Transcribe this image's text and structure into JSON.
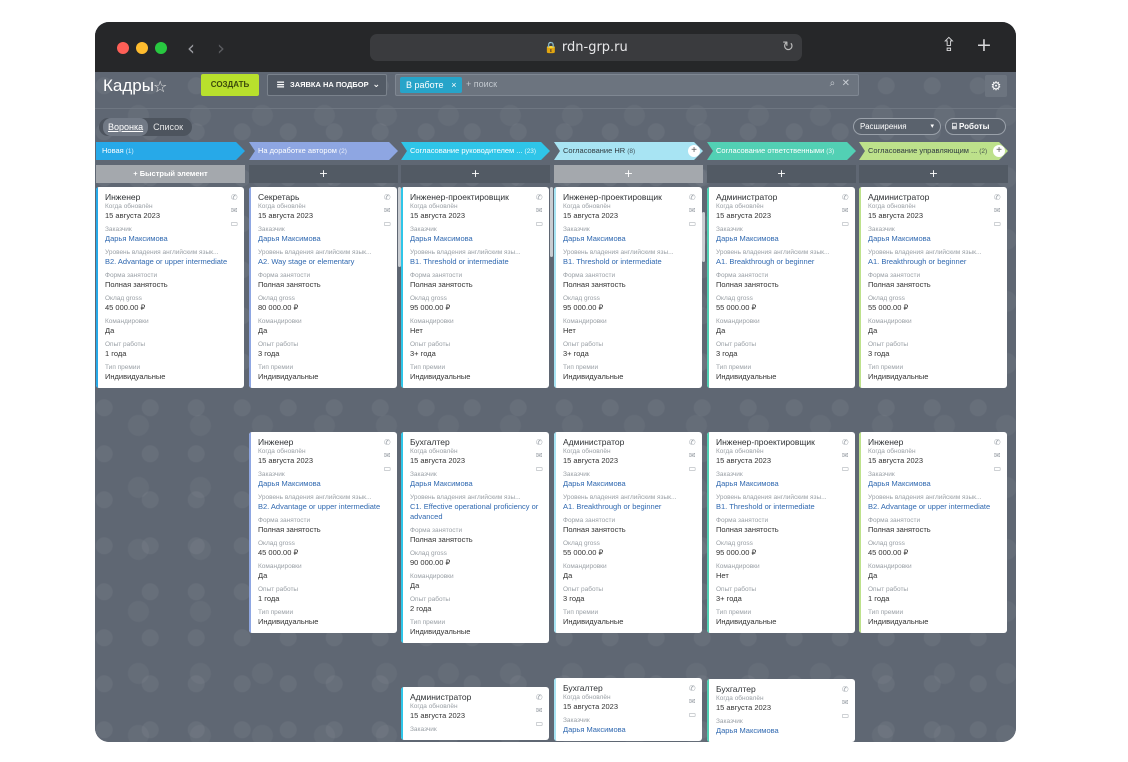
{
  "browser": {
    "url": "rdn-grp.ru",
    "back_icon": "chevron-left",
    "forward_icon": "chevron-right",
    "share_icon": "share",
    "new_tab_icon": "plus"
  },
  "header": {
    "title": "Кадры",
    "create_label": "СОЗДАТЬ",
    "filter_label": "ЗАЯВКА НА ПОДБОР",
    "search_chip": "В работе",
    "search_placeholder": "+ поиск"
  },
  "toolbar": {
    "view_funnel": "Воронка",
    "view_list": "Список",
    "extensions": "Расширения",
    "robots": "Роботы"
  },
  "colors": {
    "accent_green": "#b8e02d",
    "chip_blue": "#27a4c9",
    "link_blue": "#2f68b0"
  },
  "columns": [
    {
      "title": "Новая",
      "count": "(1)",
      "color": "#27a9e8",
      "add_label": "Быстрый элемент",
      "add_style": "quick",
      "cards": [
        {
          "title": "Инженер",
          "updated_label": "Когда обновлён",
          "updated": "15 августа 2023",
          "client_label": "Заказчик",
          "client": "Дарья Максимова",
          "english_label": "Уровень владения английским язык...",
          "english": "B2. Advantage or upper intermediate",
          "employment_label": "Форма занятости",
          "employment": "Полная занятость",
          "salary_label": "Оклад gross",
          "salary": "45 000.00 ₽",
          "trips_label": "Командировки",
          "trips": "Да",
          "experience_label": "Опыт работы",
          "experience": "1 года",
          "bonus_label": "Тип премии",
          "bonus": "Индивидуальные"
        }
      ]
    },
    {
      "title": "На доработке автором",
      "count": "(2)",
      "color": "#8ea6e2",
      "add_label": "+",
      "add_style": "plain",
      "cards": [
        {
          "title": "Секретарь",
          "updated_label": "Когда обновлён",
          "updated": "15 августа 2023",
          "client_label": "Заказчик",
          "client": "Дарья Максимова",
          "english_label": "Уровень владения английским язык...",
          "english": "A2. Way stage or elementary",
          "employment_label": "Форма занятости",
          "employment": "Полная занятость",
          "salary_label": "Оклад gross",
          "salary": "80 000.00 ₽",
          "trips_label": "Командировки",
          "trips": "Да",
          "experience_label": "Опыт работы",
          "experience": "3 года",
          "bonus_label": "Тип премии",
          "bonus": "Индивидуальные"
        },
        {
          "title": "Инженер",
          "updated_label": "Когда обновлён",
          "updated": "15 августа 2023",
          "client_label": "Заказчик",
          "client": "Дарья Максимова",
          "english_label": "Уровень владения английским язык...",
          "english": "B2. Advantage or upper intermediate",
          "employment_label": "Форма занятости",
          "employment": "Полная занятость",
          "salary_label": "Оклад gross",
          "salary": "45 000.00 ₽",
          "trips_label": "Командировки",
          "trips": "Да",
          "experience_label": "Опыт работы",
          "experience": "1 года",
          "bonus_label": "Тип премии",
          "bonus": "Индивидуальные"
        }
      ]
    },
    {
      "title": "Согласование руководителем ...",
      "count": "(23)",
      "color": "#2fc5e8",
      "add_label": "+",
      "add_style": "plain",
      "cards": [
        {
          "title": "Инженер-проектировщик",
          "updated_label": "Когда обновлён",
          "updated": "15 августа 2023",
          "client_label": "Заказчик",
          "client": "Дарья Максимова",
          "english_label": "Уровень владения английским язы...",
          "english": "B1. Threshold or intermediate",
          "employment_label": "Форма занятости",
          "employment": "Полная занятость",
          "salary_label": "Оклад gross",
          "salary": "95 000.00 ₽",
          "trips_label": "Командировки",
          "trips": "Нет",
          "experience_label": "Опыт работы",
          "experience": "3+ года",
          "bonus_label": "Тип премии",
          "bonus": "Индивидуальные"
        },
        {
          "title": "Бухгалтер",
          "updated_label": "Когда обновлён",
          "updated": "15 августа 2023",
          "client_label": "Заказчик",
          "client": "Дарья Максимова",
          "english_label": "Уровень владения английским язы...",
          "english": "C1. Effective operational proficiency or advanced",
          "employment_label": "Форма занятости",
          "employment": "Полная занятость",
          "salary_label": "Оклад gross",
          "salary": "90 000.00 ₽",
          "trips_label": "Командировки",
          "trips": "Да",
          "experience_label": "Опыт работы",
          "experience": "2 года",
          "bonus_label": "Тип премии",
          "bonus": "Индивидуальные"
        },
        {
          "title": "Администратор",
          "updated_label": "Когда обновлён",
          "updated": "15 августа 2023",
          "client_label": "Заказчик"
        }
      ]
    },
    {
      "title": "Согласование HR",
      "count": "(8)",
      "color": "#a8e4f3",
      "add_label": "+",
      "add_style": "light",
      "cards": [
        {
          "title": "Инженер-проектировщик",
          "updated_label": "Когда обновлён",
          "updated": "15 августа 2023",
          "client_label": "Заказчик",
          "client": "Дарья Максимова",
          "english_label": "Уровень владения английским язы...",
          "english": "B1. Threshold or intermediate",
          "employment_label": "Форма занятости",
          "employment": "Полная занятость",
          "salary_label": "Оклад gross",
          "salary": "95 000.00 ₽",
          "trips_label": "Командировки",
          "trips": "Нет",
          "experience_label": "Опыт работы",
          "experience": "3+ года",
          "bonus_label": "Тип премии",
          "bonus": "Индивидуальные"
        },
        {
          "title": "Администратор",
          "updated_label": "Когда обновлён",
          "updated": "15 августа 2023",
          "client_label": "Заказчик",
          "client": "Дарья Максимова",
          "english_label": "Уровень владения английским язык...",
          "english": "A1. Breakthrough or beginner",
          "employment_label": "Форма занятости",
          "employment": "Полная занятость",
          "salary_label": "Оклад gross",
          "salary": "55 000.00 ₽",
          "trips_label": "Командировки",
          "trips": "Да",
          "experience_label": "Опыт работы",
          "experience": "3 года",
          "bonus_label": "Тип премии",
          "bonus": "Индивидуальные"
        },
        {
          "title": "Бухгалтер",
          "updated_label": "Когда обновлён",
          "updated": "15 августа 2023",
          "client_label": "Заказчик",
          "client": "Дарья Максимова"
        }
      ]
    },
    {
      "title": "Согласование ответственными",
      "count": "(3)",
      "color": "#52d0b4",
      "add_label": "+",
      "add_style": "plain",
      "cards": [
        {
          "title": "Администратор",
          "updated_label": "Когда обновлён",
          "updated": "15 августа 2023",
          "client_label": "Заказчик",
          "client": "Дарья Максимова",
          "english_label": "Уровень владения английским язык...",
          "english": "A1. Breakthrough or beginner",
          "employment_label": "Форма занятости",
          "employment": "Полная занятость",
          "salary_label": "Оклад gross",
          "salary": "55 000.00 ₽",
          "trips_label": "Командировки",
          "trips": "Да",
          "experience_label": "Опыт работы",
          "experience": "3 года",
          "bonus_label": "Тип премии",
          "bonus": "Индивидуальные"
        },
        {
          "title": "Инженер-проектировщик",
          "updated_label": "Когда обновлён",
          "updated": "15 августа 2023",
          "client_label": "Заказчик",
          "client": "Дарья Максимова",
          "english_label": "Уровень владения английским язы...",
          "english": "B1. Threshold or intermediate",
          "employment_label": "Форма занятости",
          "employment": "Полная занятость",
          "salary_label": "Оклад gross",
          "salary": "95 000.00 ₽",
          "trips_label": "Командировки",
          "trips": "Нет",
          "experience_label": "Опыт работы",
          "experience": "3+ года",
          "bonus_label": "Тип премии",
          "bonus": "Индивидуальные"
        },
        {
          "title": "Бухгалтер",
          "updated_label": "Когда обновлён",
          "updated": "15 августа 2023",
          "client_label": "Заказчик",
          "client": "Дарья Максимова"
        }
      ]
    },
    {
      "title": "Согласование управляющим ...",
      "count": "(2)",
      "color": "#bde18b",
      "add_label": "+",
      "add_style": "plain",
      "cards": [
        {
          "title": "Администратор",
          "updated_label": "Когда обновлён",
          "updated": "15 августа 2023",
          "client_label": "Заказчик",
          "client": "Дарья Максимова",
          "english_label": "Уровень владения английским язык...",
          "english": "A1. Breakthrough or beginner",
          "employment_label": "Форма занятости",
          "employment": "Полная занятость",
          "salary_label": "Оклад gross",
          "salary": "55 000.00 ₽",
          "trips_label": "Командировки",
          "trips": "Да",
          "experience_label": "Опыт работы",
          "experience": "3 года",
          "bonus_label": "Тип премии",
          "bonus": "Индивидуальные"
        },
        {
          "title": "Инженер",
          "updated_label": "Когда обновлён",
          "updated": "15 августа 2023",
          "client_label": "Заказчик",
          "client": "Дарья Максимова",
          "english_label": "Уровень владения английским язык...",
          "english": "B2. Advantage or upper intermediate",
          "employment_label": "Форма занятости",
          "employment": "Полная занятость",
          "salary_label": "Оклад gross",
          "salary": "45 000.00 ₽",
          "trips_label": "Командировки",
          "trips": "Да",
          "experience_label": "Опыт работы",
          "experience": "1 года",
          "bonus_label": "Тип премии",
          "bonus": "Индивидуальные"
        }
      ]
    }
  ]
}
